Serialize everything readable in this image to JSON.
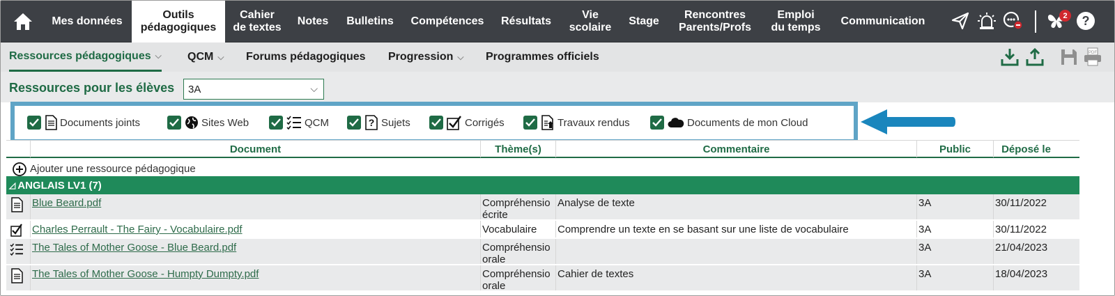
{
  "nav": {
    "items": [
      {
        "label": "Mes données"
      },
      {
        "label": "Outils\npédagogiques"
      },
      {
        "label": "Cahier\nde textes"
      },
      {
        "label": "Notes"
      },
      {
        "label": "Bulletins"
      },
      {
        "label": "Compétences"
      },
      {
        "label": "Résultats"
      },
      {
        "label": "Vie\nscolaire"
      },
      {
        "label": "Stage"
      },
      {
        "label": "Rencontres\nParents/Profs"
      },
      {
        "label": "Emploi\ndu temps"
      },
      {
        "label": "Communication"
      }
    ],
    "notification_count": "2",
    "icons": [
      "home-icon",
      "send-icon",
      "alarm-icon",
      "status-icon",
      "butterfly-icon",
      "help-icon"
    ]
  },
  "subnav": {
    "items": [
      {
        "label": "Ressources pédagogiques"
      },
      {
        "label": "QCM"
      },
      {
        "label": "Forums pédagogiques"
      },
      {
        "label": "Progression"
      },
      {
        "label": "Programmes officiels"
      }
    ],
    "tools": [
      "download-icon",
      "upload-icon",
      "save-icon",
      "print-pdf-icon"
    ]
  },
  "resources": {
    "label": "Ressources pour les élèves",
    "class_value": "3A"
  },
  "filters": [
    {
      "label": "Documents joints",
      "checked": true,
      "icon": "document-icon"
    },
    {
      "label": "Sites Web",
      "checked": true,
      "icon": "globe-icon"
    },
    {
      "label": "QCM",
      "checked": true,
      "icon": "checklist-icon"
    },
    {
      "label": "Sujets",
      "checked": true,
      "icon": "question-icon"
    },
    {
      "label": "Corrigés",
      "checked": true,
      "icon": "corrected-icon"
    },
    {
      "label": "Travaux rendus",
      "checked": true,
      "icon": "submitted-work-icon"
    },
    {
      "label": "Documents de mon Cloud",
      "checked": true,
      "icon": "cloud-icon"
    }
  ],
  "table": {
    "headers": [
      "Document",
      "Thème(s)",
      "Commentaire",
      "Public",
      "Déposé le"
    ],
    "add_label": "Ajouter une ressource pédagogique",
    "group": "ANGLAIS LV1 (7)",
    "rows": [
      {
        "icon": "document-icon",
        "document": "Blue Beard.pdf",
        "theme": "Compréhensio\nécrite",
        "comment": "Analyse de texte",
        "public": "3A",
        "date": "30/11/2022"
      },
      {
        "icon": "corrected-icon",
        "document": "Charles Perrault - The Fairy - Vocabulaire.pdf",
        "theme": "Vocabulaire",
        "comment": "Comprendre un texte en se basant sur une liste de vocabulaire",
        "public": "3A",
        "date": "30/11/2022"
      },
      {
        "icon": "checklist-icon",
        "document": "The Tales of Mother Goose - Blue Beard.pdf",
        "theme": "Compréhensio\norale",
        "comment": "",
        "public": "3A",
        "date": "21/04/2023"
      },
      {
        "icon": "document-icon",
        "document": "The Tales of Mother Goose - Humpty Dumpty.pdf",
        "theme": "Compréhensio\norale",
        "comment": "Cahier de textes",
        "public": "3A",
        "date": "18/04/2023"
      }
    ]
  }
}
